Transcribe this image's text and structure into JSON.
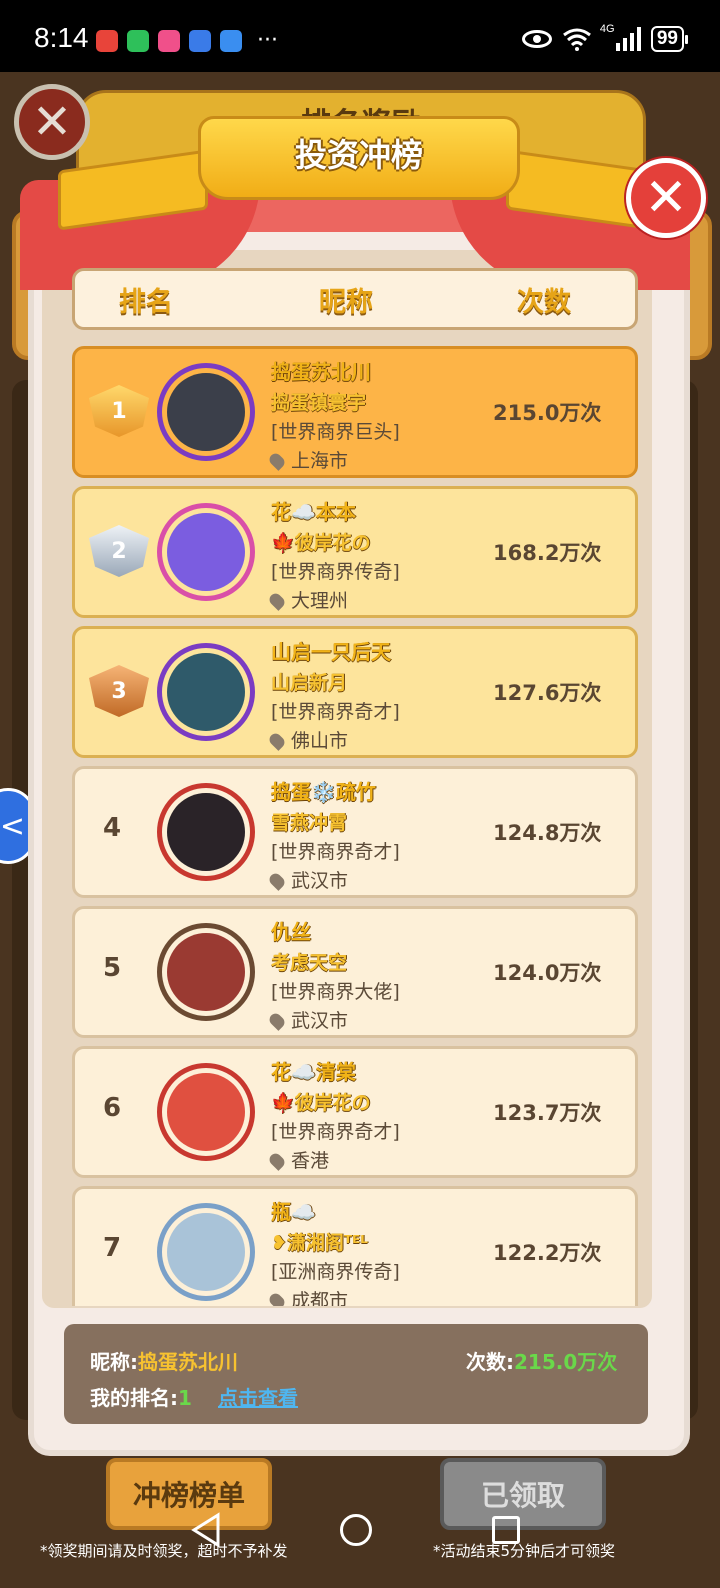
{
  "status_bar": {
    "time": "8:14",
    "network": "4G",
    "battery": "99"
  },
  "background": {
    "ribbon_title": "排名奖励",
    "button_rank_list": "冲榜榜单",
    "button_claimed": "已领取",
    "note_left": "*领奖期间请及时领奖，超时不予补发",
    "note_right": "*活动结束5分钟后才可领奖"
  },
  "popup": {
    "title": "投资冲榜",
    "close_icon": "close-icon",
    "columns": {
      "rank": "排名",
      "nickname": "昵称",
      "count": "次数"
    },
    "rows": [
      {
        "rank": "1",
        "nickname": "捣蛋苏北川",
        "team": "捣蛋镇寰宇",
        "title": "[世界商界巨头]",
        "location": "上海市",
        "count": "215.0万次"
      },
      {
        "rank": "2",
        "nickname": "花☁️本本",
        "team": "🍁彼岸花の",
        "title": "[世界商界传奇]",
        "location": "大理州",
        "count": "168.2万次"
      },
      {
        "rank": "3",
        "nickname": "山启一只后天",
        "team": "山启新月",
        "title": "[世界商界奇才]",
        "location": "佛山市",
        "count": "127.6万次"
      },
      {
        "rank": "4",
        "nickname": "捣蛋❄️疏竹",
        "team": "雪燕冲霄",
        "title": "[世界商界奇才]",
        "location": "武汉市",
        "count": "124.8万次"
      },
      {
        "rank": "5",
        "nickname": "仇丝",
        "team": "考虑天空",
        "title": "[世界商界大佬]",
        "location": "武汉市",
        "count": "124.0万次"
      },
      {
        "rank": "6",
        "nickname": "花☁️清棠",
        "team": "🍁彼岸花の",
        "title": "[世界商界奇才]",
        "location": "香港",
        "count": "123.7万次"
      },
      {
        "rank": "7",
        "nickname": "瓶☁️",
        "team": "❥潇湘阁ᵀᴱᴸ",
        "title": "[亚洲商界传奇]",
        "location": "成都市",
        "count": "122.2万次"
      }
    ],
    "my": {
      "nick_label": "昵称:",
      "nick_value": "捣蛋苏北川",
      "count_label": "次数:",
      "count_value": "215.0万次",
      "rank_label": "我的排名:",
      "rank_value": "1",
      "link": "点击查看"
    }
  }
}
